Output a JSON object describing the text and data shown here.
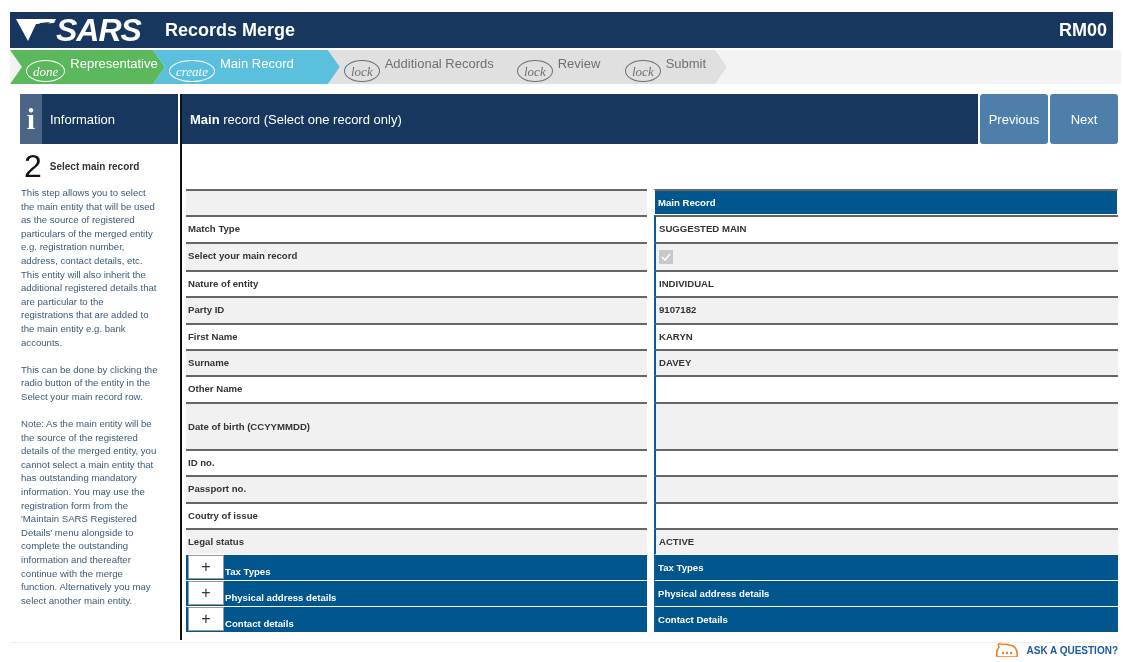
{
  "header": {
    "logo": "SARS",
    "title": "Records Merge",
    "code": "RM00"
  },
  "steps": [
    {
      "badge": "done",
      "label": "Representative",
      "completed": true,
      "selected": false,
      "disabled": false
    },
    {
      "badge": "create",
      "label": "Main Record",
      "completed": false,
      "selected": true,
      "disabled": false
    },
    {
      "badge": "lock",
      "label": "Additional Records",
      "completed": false,
      "selected": false,
      "disabled": true
    },
    {
      "badge": "lock",
      "label": "Review",
      "completed": false,
      "selected": false,
      "disabled": true
    },
    {
      "badge": "lock",
      "label": "Submit",
      "completed": false,
      "selected": false,
      "disabled": true
    }
  ],
  "info": {
    "icon": "i",
    "title": "Information",
    "step_number": "2",
    "step_title": "Select main record",
    "paragraphs": [
      "This step allows you to select the main entity that will be used as the source of registered particulars of the merged entity e.g. registration number, address, contact details, etc. This entity will also inherit the additional registered details that are particular to the registrations that are added to the main entity e.g. bank accounts.",
      "This can be done by clicking the radio button of the entity in the Select your main record row.",
      "Note: As the main entity will be the source of the registered details of the merged entity, you cannot select a main entity that has outstanding mandatory information. You may use the registration form from the 'Maintain SARS Registered Details' menu alongside to complete the outstanding information and thereafter continue with the merge function. Alternatively you may select another main entity."
    ]
  },
  "main": {
    "title": "**Main** record (Select one record only)",
    "buttons": [
      "Previous",
      "Next"
    ]
  },
  "record": {
    "column_header": "Main Record",
    "rows": [
      {
        "label": "Match Type",
        "kind": "text",
        "value": "SUGGESTED MAIN"
      },
      {
        "label": "Select your main record",
        "kind": "checkbox",
        "checked": true
      },
      {
        "label": "Nature of entity",
        "kind": "text",
        "value": "INDIVIDUAL"
      },
      {
        "label": "Party ID",
        "kind": "text",
        "value": "9107182"
      },
      {
        "label": "First Name",
        "kind": "text",
        "value": "KARYN"
      },
      {
        "label": "Surname",
        "kind": "text",
        "value": "DAVEY"
      },
      {
        "label": "Other Name",
        "kind": "text"
      },
      {
        "label": "Date of birth (CCYYMMDD)",
        "kind": "date"
      },
      {
        "label": "ID no.",
        "kind": "text"
      },
      {
        "label": "Passport no.",
        "kind": "text"
      },
      {
        "label": "Coutry of issue",
        "kind": "text"
      },
      {
        "label": "Legal status",
        "kind": "text",
        "value": "ACTIVE"
      }
    ],
    "sections": [
      {
        "toggle": "+",
        "label": "Tax Types",
        "value": "Tax Types"
      },
      {
        "toggle": "+",
        "label": "Physical address details",
        "value": "Physical address details"
      },
      {
        "toggle": "+",
        "label": "Contact details",
        "value": "Contact Details"
      }
    ]
  },
  "help": {
    "label": "ASK A QUESTION?"
  }
}
